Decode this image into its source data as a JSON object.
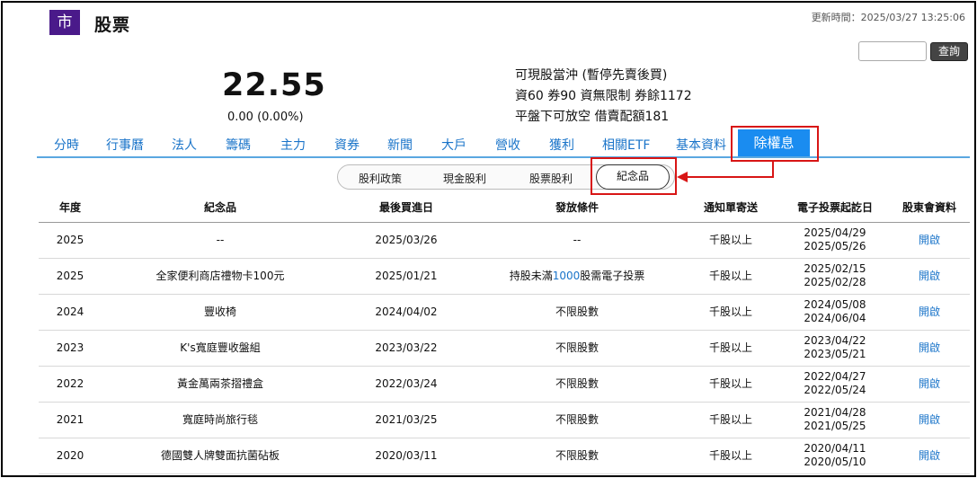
{
  "header": {
    "badge": "市",
    "title": "股票",
    "update_time": "更新時間：2025/03/27 13:25:06",
    "search_button": "查詢",
    "search_value": ""
  },
  "quote": {
    "price": "22.55",
    "change": "0.00 (0.00%)",
    "info": [
      "可現股當沖 (暫停先賣後買)",
      "資60 券90 資無限制 券餘1172",
      "平盤下可放空 借賣配額181"
    ]
  },
  "tabs": [
    "分時",
    "行事曆",
    "法人",
    "籌碼",
    "主力",
    "資券",
    "新聞",
    "大戶",
    "營收",
    "獲利",
    "相關ETF",
    "基本資料"
  ],
  "active_tab": "除權息",
  "subtabs": [
    "股利政策",
    "現金股利",
    "股票股利"
  ],
  "active_subtab": "紀念品",
  "table": {
    "headers": [
      "年度",
      "紀念品",
      "最後買進日",
      "發放條件",
      "通知單寄送",
      "電子投票起訖日",
      "股東會資料"
    ],
    "rows": [
      {
        "year": "2025",
        "gift": "--",
        "last_buy": "2025/03/26",
        "condition": "--",
        "notice": "千股以上",
        "vote_start": "2025/04/29",
        "vote_end": "2025/05/26",
        "link": "開啟"
      },
      {
        "year": "2025",
        "gift": "全家便利商店禮物卡100元",
        "last_buy": "2025/01/21",
        "condition_pre": "持股未滿",
        "condition_num": "1000",
        "condition_post": "股需電子投票",
        "notice": "千股以上",
        "vote_start": "2025/02/15",
        "vote_end": "2025/02/28",
        "link": "開啟"
      },
      {
        "year": "2024",
        "gift": "豐收椅",
        "last_buy": "2024/04/02",
        "condition": "不限股數",
        "notice": "千股以上",
        "vote_start": "2024/05/08",
        "vote_end": "2024/06/04",
        "link": "開啟"
      },
      {
        "year": "2023",
        "gift": "K's寬庭豐收盤組",
        "last_buy": "2023/03/22",
        "condition": "不限股數",
        "notice": "千股以上",
        "vote_start": "2023/04/22",
        "vote_end": "2023/05/21",
        "link": "開啟"
      },
      {
        "year": "2022",
        "gift": "黃金萬兩茶摺禮盒",
        "last_buy": "2022/03/24",
        "condition": "不限股數",
        "notice": "千股以上",
        "vote_start": "2022/04/27",
        "vote_end": "2022/05/24",
        "link": "開啟"
      },
      {
        "year": "2021",
        "gift": "寬庭時尚旅行毯",
        "last_buy": "2021/03/25",
        "condition": "不限股數",
        "notice": "千股以上",
        "vote_start": "2021/04/28",
        "vote_end": "2021/05/25",
        "link": "開啟"
      },
      {
        "year": "2020",
        "gift": "德國雙人牌雙面抗菌砧板",
        "last_buy": "2020/03/11",
        "condition": "不限股數",
        "notice": "千股以上",
        "vote_start": "2020/04/11",
        "vote_end": "2020/05/10",
        "link": "開啟"
      }
    ]
  },
  "colors": {
    "accent": "#1a8cf0",
    "link": "#1a74c9",
    "badge": "#4a1a8a",
    "highlight": "#d81515"
  }
}
